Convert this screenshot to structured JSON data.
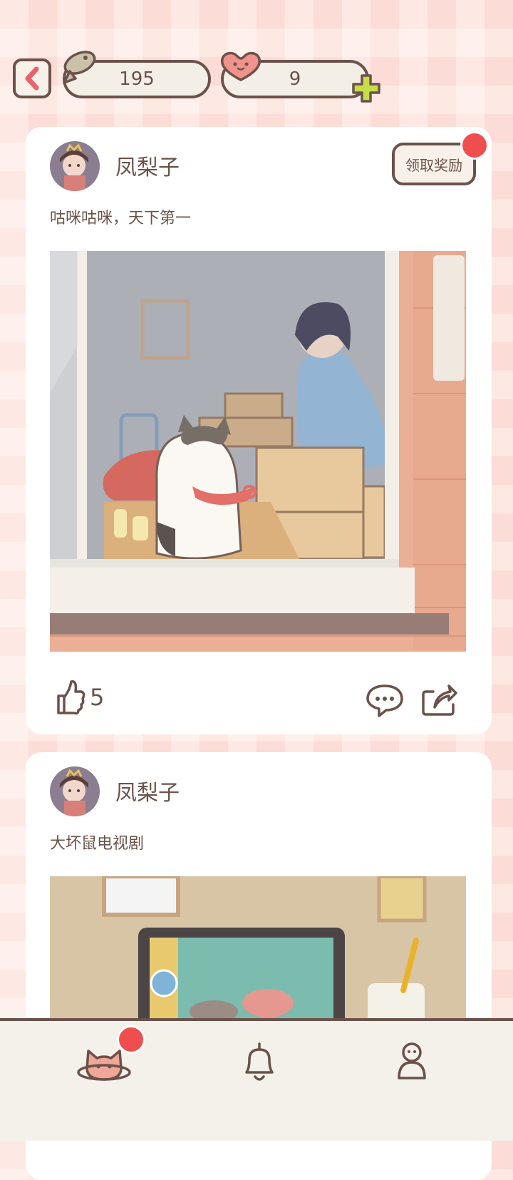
{
  "header": {
    "fish_count": "195",
    "heart_count": "9"
  },
  "posts": [
    {
      "username": "凤梨子",
      "text": "咕咪咕咪，天下第一",
      "reward_label": "领取奖励",
      "likes": "5"
    },
    {
      "username": "凤梨子",
      "text": "大坏鼠电视剧"
    }
  ],
  "nav": {
    "items": [
      "home-cat-icon",
      "bell-icon",
      "profile-icon"
    ]
  },
  "colors": {
    "outline": "#6b524a",
    "notification": "#f04e4e",
    "accent_green": "#c5de48"
  }
}
